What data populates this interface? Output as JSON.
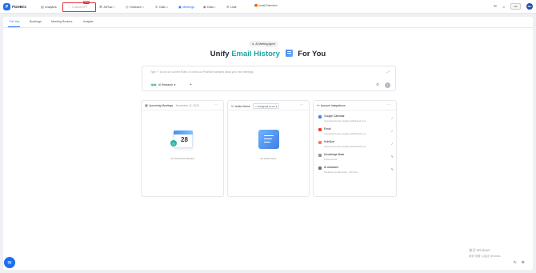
{
  "app": {
    "name": "PixieBrix",
    "logo_letter": "P"
  },
  "nav": {
    "analytics": "Analytics",
    "customgpt": "CustomGPT",
    "customgpt_badge": "New",
    "aiflow": "AIFlow",
    "outreach": "Outreach",
    "calls": "Calls",
    "meetings": "Meetings",
    "data": "Data",
    "lists": "Lists",
    "extension": "Install Extension",
    "lite_label": "Lite",
    "avatar_initials": "WH"
  },
  "tabs": [
    {
      "label": "For You"
    },
    {
      "label": "Bookings"
    },
    {
      "label": "Meeting Routers"
    },
    {
      "label": "Insights"
    }
  ],
  "hero": {
    "pill": "AI Meeting Agent",
    "prefix": "Unify",
    "accent": "Email History",
    "suffix": "For You"
  },
  "prompt": {
    "placeholder": "Type \"/\" to use our current Rules, or check out PixieBot examples about your next meetings",
    "new_chip": "NEW",
    "research_label": "AI Research"
  },
  "cards": {
    "upcoming": {
      "title": "Upcoming Meetings",
      "date": "November 11, 2024",
      "calendar_day": "28",
      "empty": "No Scheduled Meeting"
    },
    "actions": {
      "title": "Action Items",
      "dropdown": "Assigned to me",
      "empty": "No action items"
    },
    "integrations": {
      "title": "Account Integrations",
      "items": [
        {
          "name": "Google Calendar",
          "sub": "Connected to the.user@mythirdcloud.com",
          "color": "#4285f4",
          "action": "check"
        },
        {
          "name": "Email",
          "sub": "Connected to the.user@mythirdcloud.com",
          "color": "#ea4335",
          "action": "check"
        },
        {
          "name": "HubSpot",
          "sub": "Connected to the.user@mythirdcloud.com",
          "color": "#ff7a59",
          "action": "check"
        },
        {
          "name": "Knowledge Base",
          "sub": "6 documents",
          "color": "#8a94a6",
          "action": "edit"
        },
        {
          "name": "AI Assistant",
          "sub": "Positioned to Reminder · 3M mins",
          "color": "#6b7280",
          "action": "edit"
        }
      ]
    }
  },
  "watermark": {
    "title": "激活 Windows",
    "sub": "转到\"设置\"以激活 Windows"
  }
}
